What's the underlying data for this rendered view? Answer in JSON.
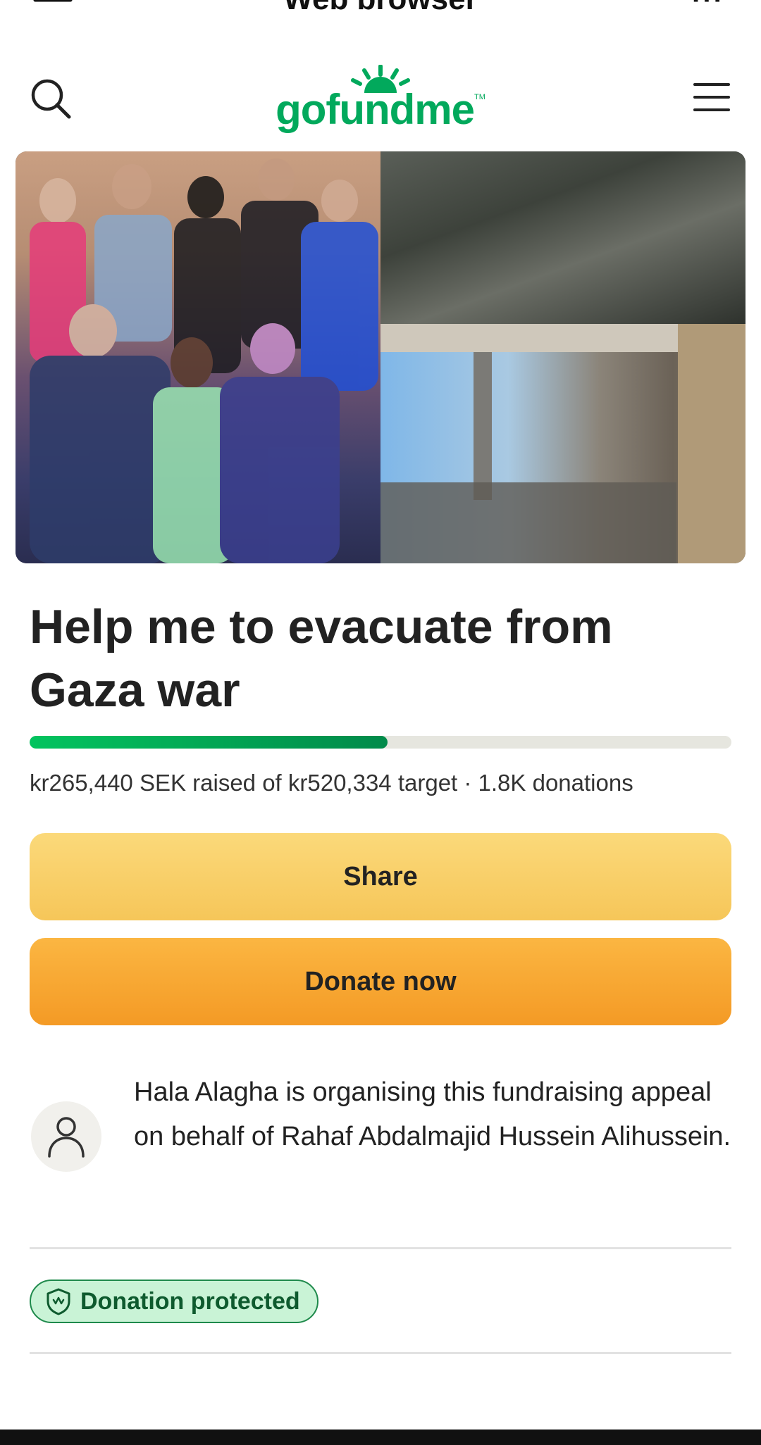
{
  "browser": {
    "title": "Web browser",
    "more_label": "···"
  },
  "header": {
    "logo_text": "gofundme",
    "logo_tm": "TM",
    "brand_color": "#02a95c",
    "icons": {
      "search": "search-icon",
      "menu": "hamburger-menu-icon"
    }
  },
  "campaign": {
    "title": "Help me to evacuate from Gaza war",
    "progress_fraction": 0.51,
    "raised_text": "kr265,440 SEK raised of kr520,334 target · 1.8K donations",
    "share_label": "Share",
    "donate_label": "Donate now",
    "organiser_text": "Hala Alagha is organising this fundraising appeal on behalf of Rahaf Abdalmajid Hussein Alihussein.",
    "protected_label": "Donation protected"
  },
  "colors": {
    "share_button": "#f8ce66",
    "donate_button": "#f7a832",
    "progress": "#02a95c",
    "badge_bg": "#c9f3d6"
  }
}
